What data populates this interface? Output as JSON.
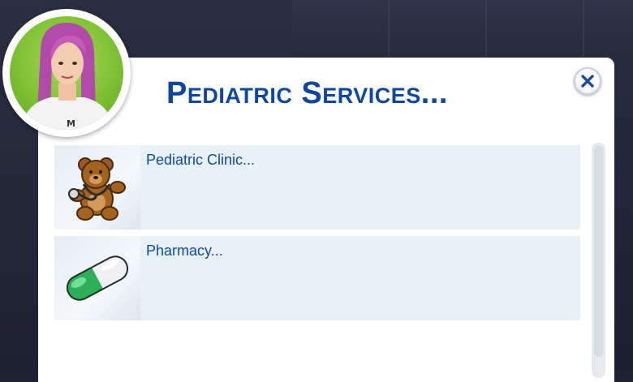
{
  "dialog": {
    "title": "Pediatric Services...",
    "close_icon": "close-x-icon"
  },
  "avatar": {
    "icon": "sim-portrait"
  },
  "options": [
    {
      "label": "Pediatric Clinic...",
      "icon": "teddy-bear-stethoscope-icon"
    },
    {
      "label": "Pharmacy...",
      "icon": "pill-capsule-icon"
    }
  ],
  "colors": {
    "title": "#0f46a0",
    "row_bg": "#e9f1f8",
    "avatar_bg": "#7fc133"
  }
}
